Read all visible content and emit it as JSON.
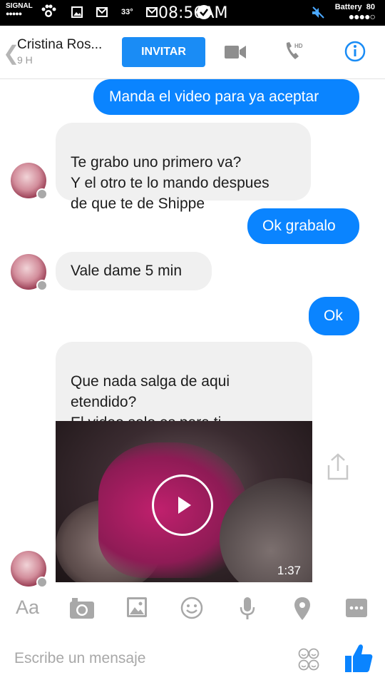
{
  "status_bar": {
    "signal_label": "SIGNAL",
    "signal_dots": "●●●●●",
    "temperature": "33°",
    "time": "08:56AM",
    "battery_label": "Battery",
    "battery_level": "80",
    "battery_dots": "●●●●○"
  },
  "header": {
    "back_glyph": "❮",
    "contact_name": "Cristina Ros...",
    "contact_status": "9 H",
    "invite_label": "INVITAR",
    "icons": [
      "video-call-icon",
      "hd-call-icon",
      "info-icon"
    ],
    "accent_color": "#1a8cf5"
  },
  "messages": [
    {
      "direction": "sent",
      "text": "Manda el video para ya aceptar"
    },
    {
      "direction": "received",
      "text": "Te grabo uno primero va?\nY el otro te lo mando despues\nde que te de Shippe"
    },
    {
      "direction": "sent",
      "text": "Ok grabalo"
    },
    {
      "direction": "received",
      "text": "Vale dame 5 min"
    },
    {
      "direction": "sent",
      "text": "Ok"
    },
    {
      "direction": "received",
      "text": "Que nada salga de aqui\netendido?\nEl video solo es para ti"
    }
  ],
  "video": {
    "duration": "1:37",
    "share_icon": "share-icon"
  },
  "toolbar": {
    "text_label": "Aa",
    "icons": [
      "camera-icon",
      "gallery-icon",
      "emoji-icon",
      "microphone-icon",
      "location-icon",
      "more-icon"
    ]
  },
  "composer": {
    "placeholder": "Escribe un mensaje",
    "icons": [
      "stickers-icon",
      "thumbs-up-icon"
    ]
  },
  "colors": {
    "sent_bubble": "#0a84ff",
    "received_bubble": "#f0f0f0"
  }
}
